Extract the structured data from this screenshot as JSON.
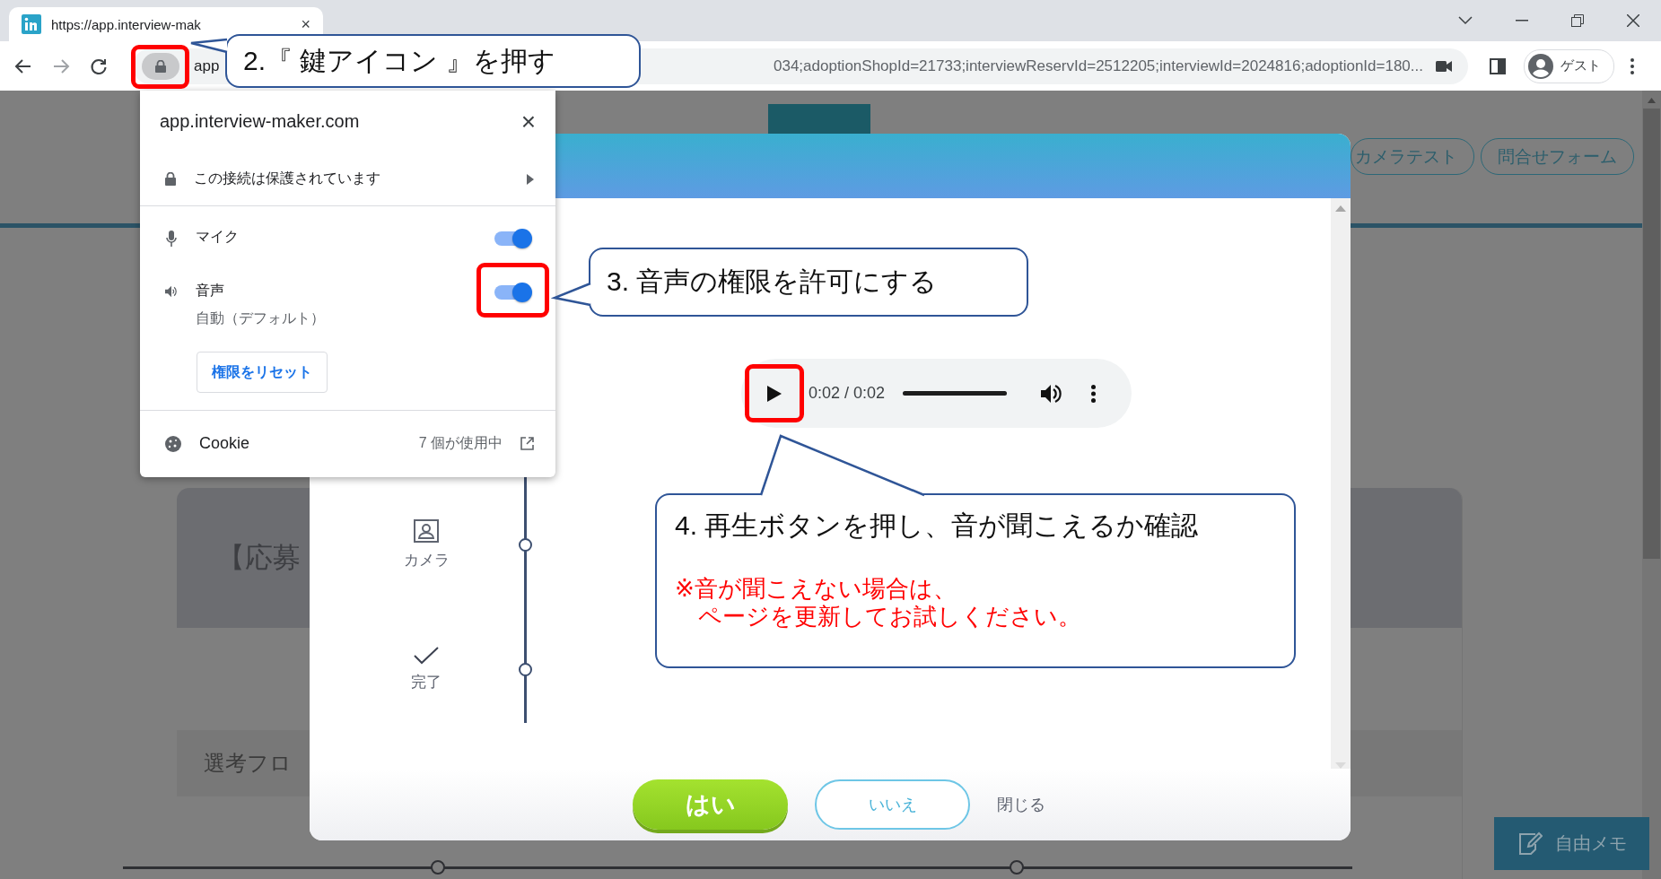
{
  "browser": {
    "tab": {
      "title": "https://app.interview-mak",
      "close": "×"
    },
    "address": {
      "host": "app",
      "url": "034;adoptionShopId=21733;interviewReservId=2512205;interviewId=2024816;adoptionId=180..."
    },
    "profile": "ゲスト"
  },
  "page": {
    "nav_buttons": [
      "カメラテスト",
      "問合せフォーム"
    ],
    "card_title": "【応募",
    "section_title": "選考フロ",
    "memo_button": "自由メモ"
  },
  "site_info": {
    "host": "app.interview-maker.com",
    "close": "×",
    "connection": "この接続は保護されています",
    "permissions": [
      {
        "kind": "mic",
        "label": "マイク",
        "on": true
      },
      {
        "kind": "sound",
        "label": "音声",
        "detail": "自動（デフォルト）",
        "on": true
      }
    ],
    "reset_button": "権限をリセット",
    "cookie": {
      "label": "Cookie",
      "count": "7 個が使用中"
    }
  },
  "modal": {
    "steps": [
      {
        "kind": "camera",
        "label": "カメラ"
      },
      {
        "kind": "done",
        "label": "完了"
      }
    ],
    "player": {
      "time": "0:02 / 0:02",
      "level": 1
    },
    "buttons": [
      {
        "kind": "primary",
        "label": "はい"
      },
      {
        "kind": "secondary",
        "label": "いいえ"
      },
      {
        "kind": "link",
        "label": "閉じる"
      }
    ]
  },
  "callouts": [
    {
      "text": "2.『 鍵アイコン 』を押す"
    },
    {
      "text": "3. 音声の権限を許可にする"
    },
    {
      "text": "4. 再生ボタンを押し、音が聞こえるか確認",
      "note_lines": [
        "※音が聞こえない場合は、",
        "ページを更新してお試しください。"
      ]
    }
  ]
}
